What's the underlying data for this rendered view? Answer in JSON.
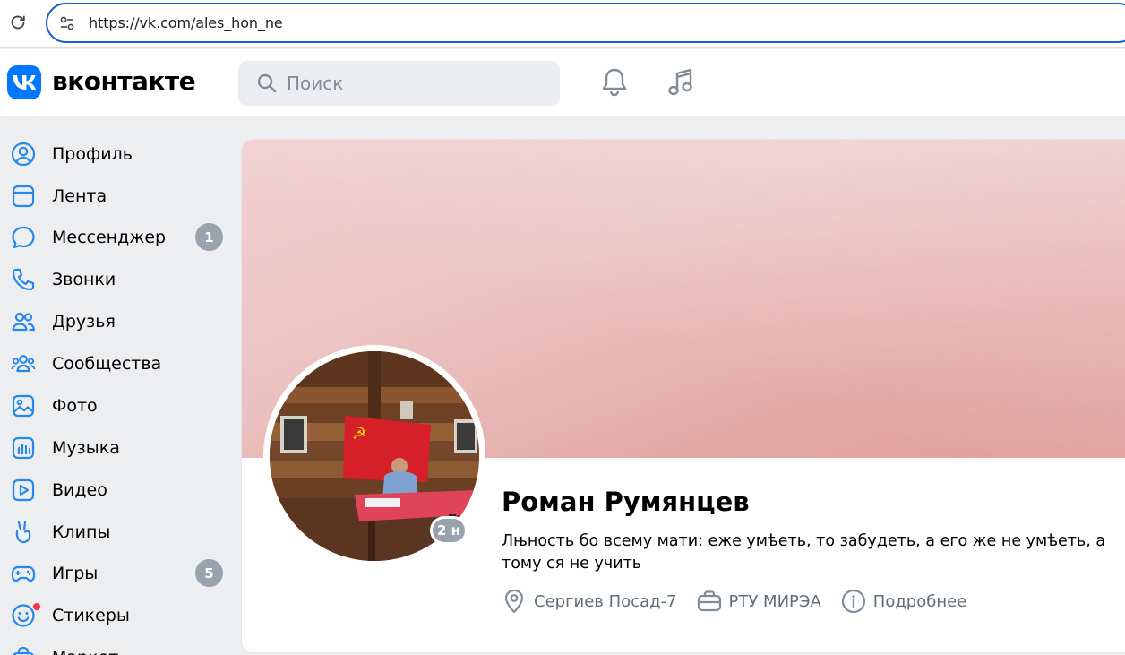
{
  "browser": {
    "url": "https://vk.com/ales_hon_ne"
  },
  "header": {
    "logo_text": "вконтакте",
    "search_placeholder": "Поиск"
  },
  "sidebar": {
    "items": [
      {
        "label": "Профиль",
        "icon": "user-circle-icon"
      },
      {
        "label": "Лента",
        "icon": "feed-icon"
      },
      {
        "label": "Мессенджер",
        "icon": "chat-bubble-icon",
        "badge": "1"
      },
      {
        "label": "Звонки",
        "icon": "phone-icon"
      },
      {
        "label": "Друзья",
        "icon": "friends-icon"
      },
      {
        "label": "Сообщества",
        "icon": "communities-icon"
      },
      {
        "label": "Фото",
        "icon": "photo-icon"
      },
      {
        "label": "Музыка",
        "icon": "music-bars-icon"
      },
      {
        "label": "Видео",
        "icon": "video-icon"
      },
      {
        "label": "Клипы",
        "icon": "clips-icon"
      },
      {
        "label": "Игры",
        "icon": "gamepad-icon",
        "badge": "5"
      },
      {
        "label": "Стикеры",
        "icon": "smile-icon"
      },
      {
        "label": "Маркет",
        "icon": "market-icon"
      }
    ]
  },
  "profile": {
    "name": "Роман Румянцев",
    "status": "Лњность бо всему мати: еже умѣеть, то забудеть, а его же не умѣеть, а тому ся не учить",
    "online_badge": "2 н",
    "city": "Сергиев Посад-7",
    "university": "РТУ МИРЭА",
    "more_label": "Подробнее"
  },
  "colors": {
    "accent": "#0077ff",
    "badge": "#99a2ad",
    "notification_dot": "#ff3347",
    "url_border": "#1a5fd0"
  }
}
